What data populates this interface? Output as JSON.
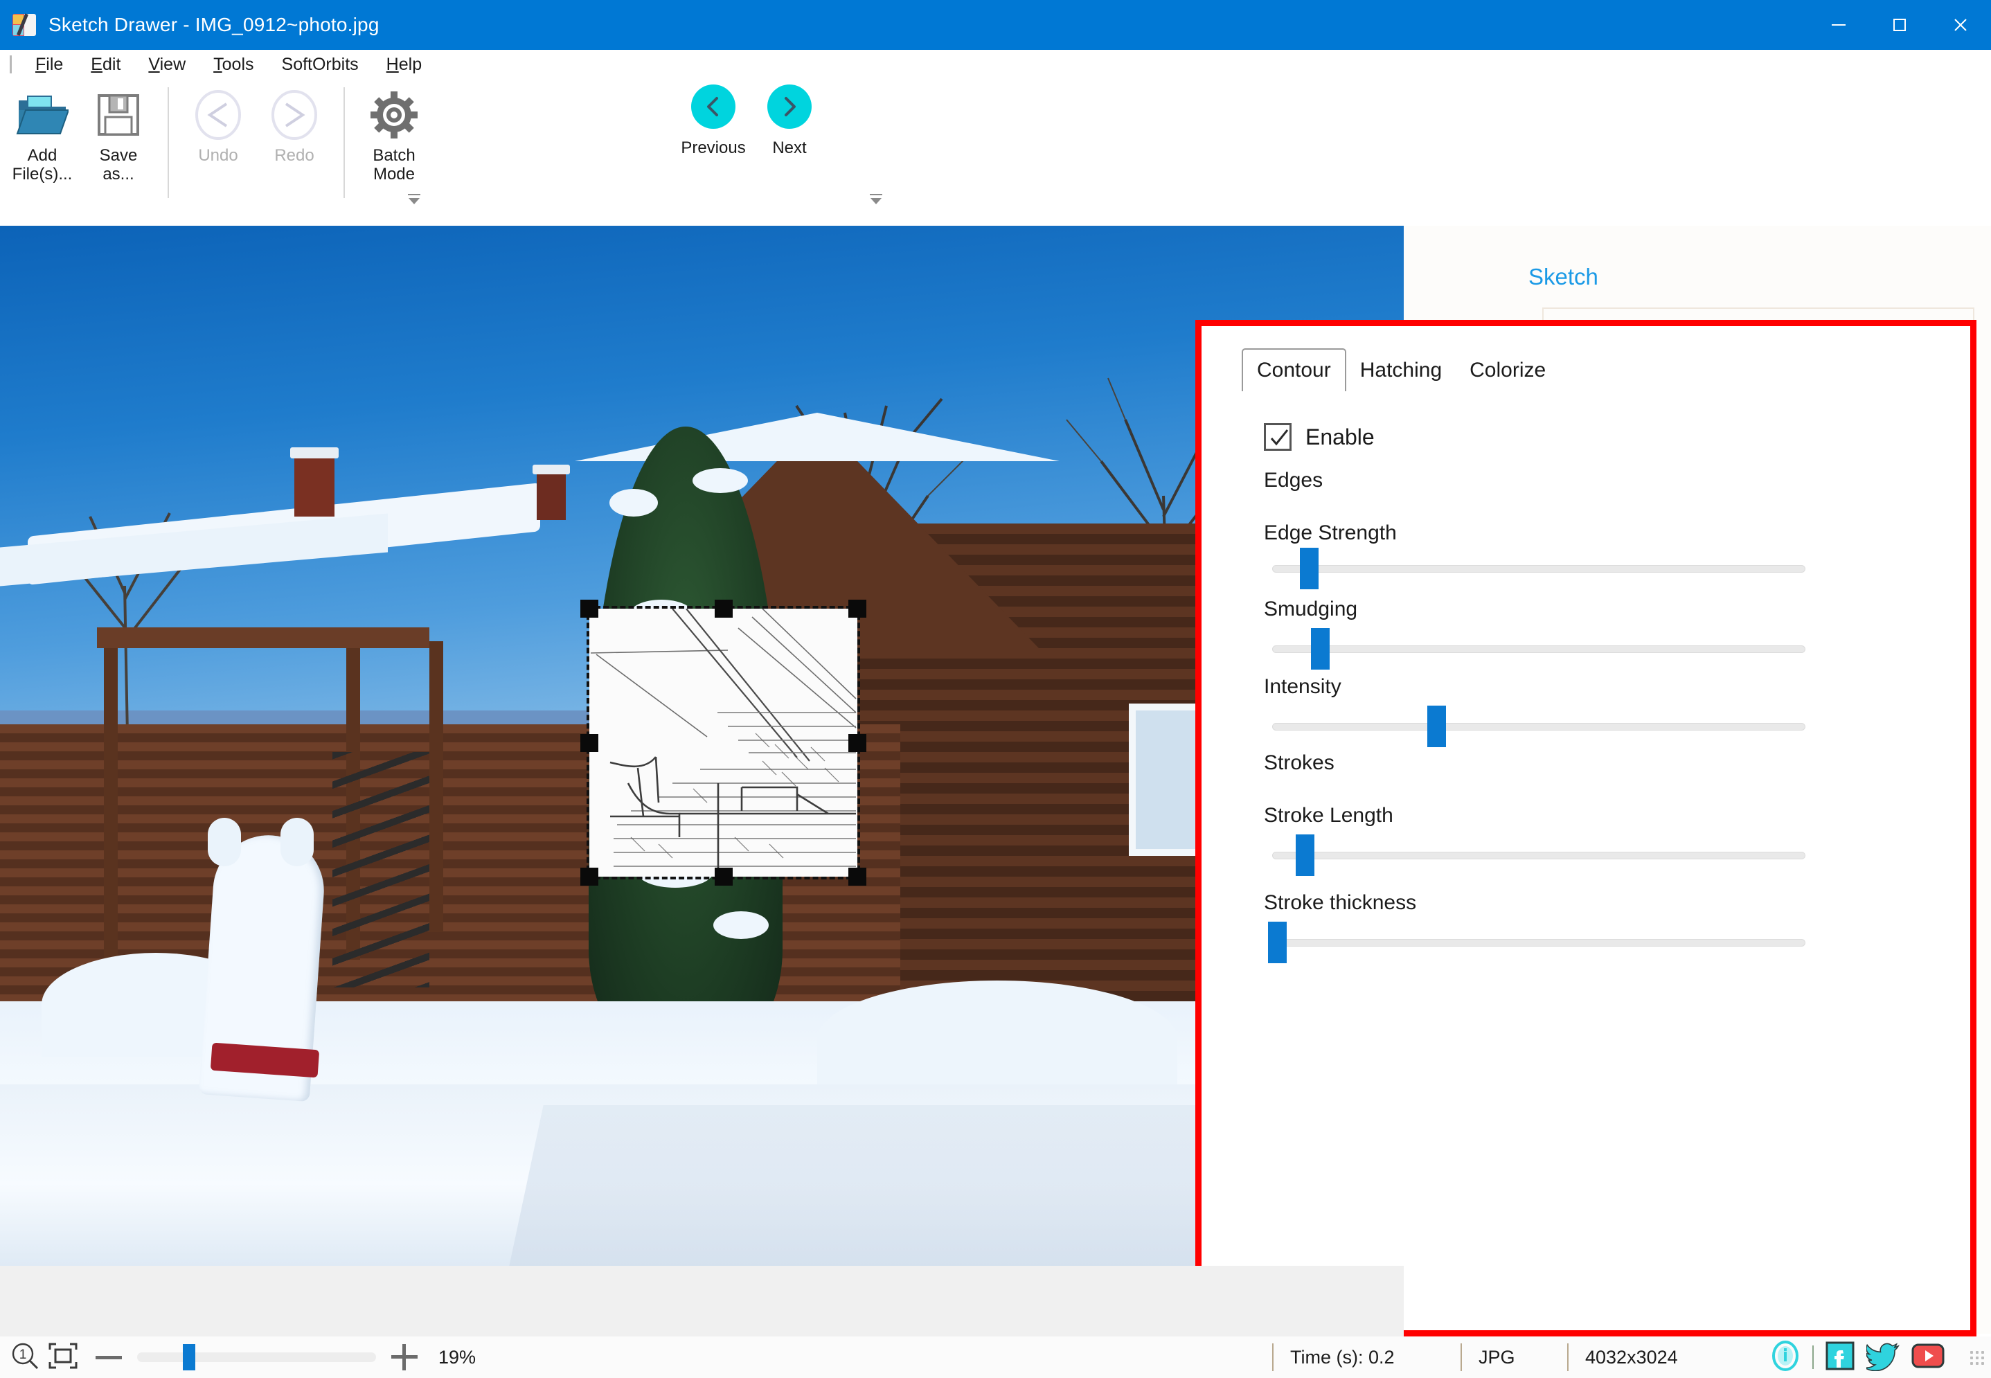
{
  "window": {
    "title": "Sketch Drawer - IMG_0912~photo.jpg",
    "app_icon": "sketch-drawer-logo-icon",
    "minimize_label": "–",
    "maximize_label": "□",
    "close_label": "×"
  },
  "menu": {
    "items": [
      {
        "accel": "F",
        "rest": "ile"
      },
      {
        "accel": "E",
        "rest": "dit"
      },
      {
        "accel": "V",
        "rest": "iew"
      },
      {
        "accel": "T",
        "rest": "ools"
      },
      {
        "accel": "",
        "rest": "SoftOrbits"
      },
      {
        "accel": "H",
        "rest": "elp"
      }
    ]
  },
  "toolbar": {
    "add_files": "Add\nFile(s)...",
    "add_files_line1": "Add",
    "add_files_line2": "File(s)...",
    "save_as_line1": "Save",
    "save_as_line2": "as...",
    "undo": "Undo",
    "redo": "Redo",
    "batch_line1": "Batch",
    "batch_line2": "Mode",
    "previous": "Previous",
    "next": "Next"
  },
  "panel": {
    "title": "Sketch",
    "tabs": [
      {
        "label": "Contour",
        "active": true
      },
      {
        "label": "Hatching",
        "active": false
      },
      {
        "label": "Colorize",
        "active": false
      }
    ],
    "enable_label": "Enable",
    "enable_checked": true,
    "groups": [
      {
        "heading": "Edges"
      },
      {
        "heading": "Strokes"
      }
    ],
    "edges_heading": "Edges",
    "strokes_heading": "Strokes",
    "sliders": [
      {
        "label": "Edge Strength",
        "value_pct": 6
      },
      {
        "label": "Smudging",
        "value_pct": 8
      },
      {
        "label": "Intensity",
        "value_pct": 30
      },
      {
        "label": "Stroke Length",
        "value_pct": 5
      },
      {
        "label": "Stroke thickness",
        "value_pct": 0
      }
    ]
  },
  "statusbar": {
    "zoom_one_to_one_icon": "zoom-actual-size-icon",
    "fit_icon": "fit-to-window-icon",
    "zoom_out_icon": "minus-icon",
    "zoom_in_icon": "plus-icon",
    "zoom_value": "19%",
    "zoom_slider_pct": 19,
    "time_label": "Time (s): 0.2",
    "format": "JPG",
    "dimensions": "4032x3024",
    "icons": [
      "info-icon",
      "facebook-icon",
      "twitter-icon",
      "youtube-icon"
    ]
  },
  "colors": {
    "titlebar": "#0078d4",
    "accent_blue": "#0b7ad1",
    "panel_link": "#1b9ae6",
    "nav_button": "#00d4de",
    "highlight_border": "#ff0000",
    "social_cyan": "#2fd3de",
    "youtube_red": "#ef4d4d"
  },
  "canvas": {
    "selection_label": "sketch-preview-selection",
    "handles": 8
  }
}
